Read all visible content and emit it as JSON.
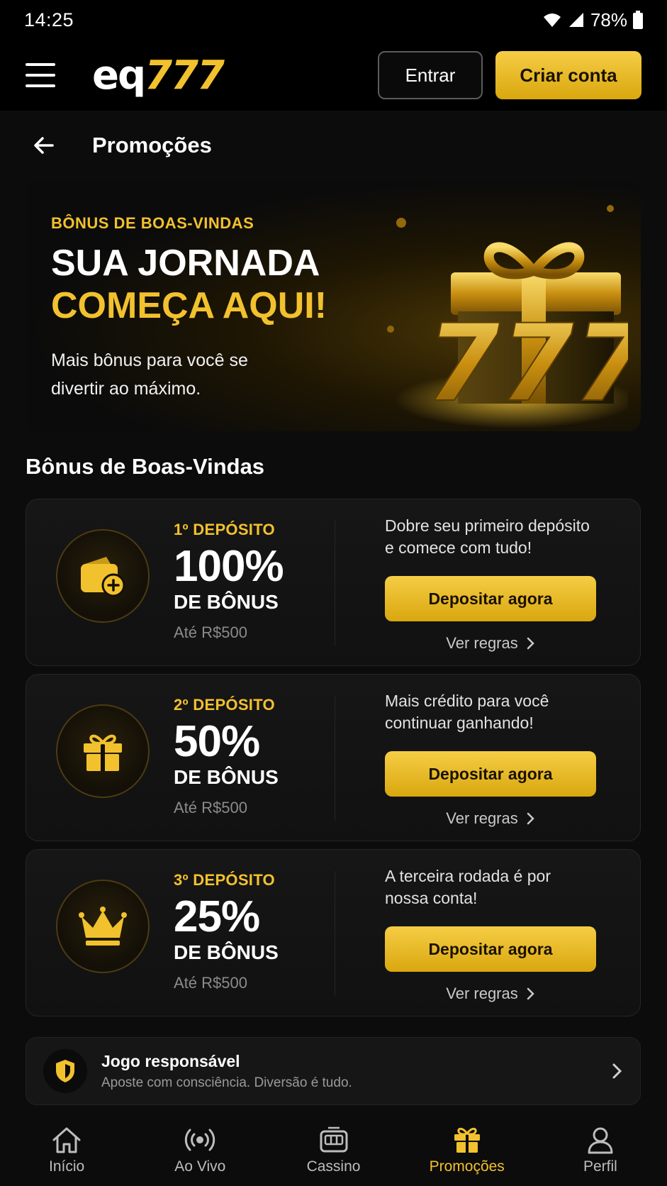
{
  "status_bar": {
    "time": "14:25",
    "battery": "78%"
  },
  "header": {
    "logo_main": "eq",
    "logo_accent": "777",
    "login_label": "Entrar",
    "signup_label": "Criar conta"
  },
  "page": {
    "title": "Promoções"
  },
  "hero": {
    "kicker": "BÔNUS DE BOAS-VINDAS",
    "title_line1": "SUA JORNADA",
    "title_line2": "COMEÇA AQUI!",
    "subtitle": "Mais bônus para você se divertir ao máximo.",
    "art_text": "777"
  },
  "section": {
    "title": "Bônus de Boas-Vindas"
  },
  "bonuses": [
    {
      "label": "1º DEPÓSITO",
      "percent": "100%",
      "unit": "DE BÔNUS",
      "limit": "Até R$500",
      "description": "Dobre seu primeiro depósito e comece com tudo!",
      "cta": "Depositar agora",
      "rules": "Ver regras",
      "icon": "wallet-plus-icon"
    },
    {
      "label": "2º DEPÓSITO",
      "percent": "50%",
      "unit": "DE BÔNUS",
      "limit": "Até R$500",
      "description": "Mais crédito para você continuar ganhando!",
      "cta": "Depositar agora",
      "rules": "Ver regras",
      "icon": "gift-icon"
    },
    {
      "label": "3º DEPÓSITO",
      "percent": "25%",
      "unit": "DE BÔNUS",
      "limit": "Até R$500",
      "description": "A terceira rodada é por nossa conta!",
      "cta": "Depositar agora",
      "rules": "Ver regras",
      "icon": "crown-icon"
    }
  ],
  "responsible": {
    "title": "Jogo responsável",
    "subtitle": "Aposte com consciência. Diversão é tudo."
  },
  "bottom_nav": [
    {
      "label": "Início",
      "icon": "home-icon",
      "active": false
    },
    {
      "label": "Ao Vivo",
      "icon": "live-icon",
      "active": false
    },
    {
      "label": "Cassino",
      "icon": "slot-machine-icon",
      "active": false
    },
    {
      "label": "Promoções",
      "icon": "gift-icon",
      "active": true
    },
    {
      "label": "Perfil",
      "icon": "user-icon",
      "active": false
    }
  ],
  "colors": {
    "accent": "#f2c12e",
    "background": "#0c0c0c",
    "card": "#161616"
  }
}
